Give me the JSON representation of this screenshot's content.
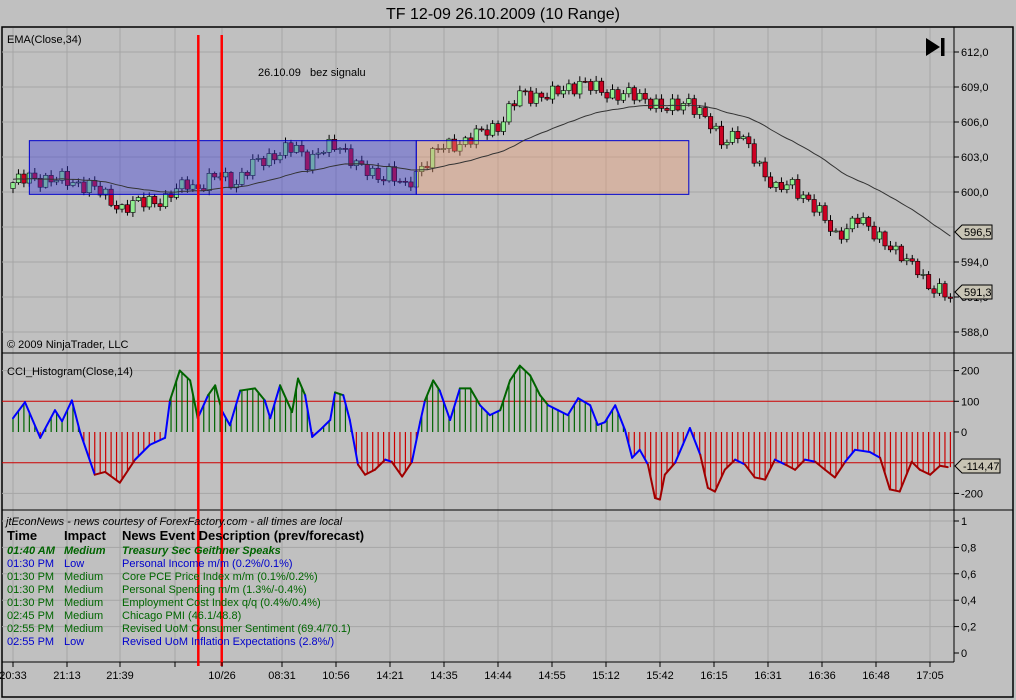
{
  "window": {
    "title": "TF 12-09  26.10.2009 (10 Range)"
  },
  "price_panel": {
    "indicator_label": "EMA(Close,34)",
    "annotation": "26.10.09   bez signalu",
    "copyright": "© 2009 NinjaTrader, LLC",
    "axis_ticks": [
      "612,0",
      "609,0",
      "606,0",
      "603,0",
      "600,0",
      "594,0",
      "591,0",
      "588,0"
    ],
    "ema_badge": "596,5",
    "last_price_badge": "591,3",
    "scroll_end_icon": "skip-to-end-icon"
  },
  "cci_panel": {
    "indicator_label": "CCI_Histogram(Close,14)",
    "axis_ticks": [
      "200",
      "100",
      "0",
      "-200"
    ],
    "value_badge": "-114,47"
  },
  "news_panel": {
    "source": "jtEconNews - news courtesy of ForexFactory.com - all times are local",
    "headers": {
      "time": "Time",
      "impact": "Impact",
      "event": "News Event Description (prev/forecast)"
    },
    "rows": [
      {
        "time": "01:40 AM",
        "impact": "Medium",
        "event": "Treasury Sec Geithner Speaks",
        "color": "#006400",
        "style": "highlight"
      },
      {
        "time": "01:30 PM",
        "impact": "Low",
        "event": "Personal Income m/m (0.2%/0.1%)",
        "color": "#0000cc"
      },
      {
        "time": "01:30 PM",
        "impact": "Medium",
        "event": "Core PCE Price Index m/m (0.1%/0.2%)",
        "color": "#006600"
      },
      {
        "time": "01:30 PM",
        "impact": "Medium",
        "event": "Personal Spending m/m (1.3%/-0.4%)",
        "color": "#006600"
      },
      {
        "time": "01:30 PM",
        "impact": "Medium",
        "event": "Employment Cost Index q/q (0.4%/0.4%)",
        "color": "#006600"
      },
      {
        "time": "02:45 PM",
        "impact": "Medium",
        "event": "Chicago PMI (46.1/48.8)",
        "color": "#006600"
      },
      {
        "time": "02:55 PM",
        "impact": "Medium",
        "event": "Revised UoM Consumer Sentiment (69.4/70.1)",
        "color": "#006600"
      },
      {
        "time": "02:55 PM",
        "impact": "Low",
        "event": "Revised UoM Inflation Expectations (2.8%/)",
        "color": "#0000cc"
      }
    ],
    "axis_ticks": [
      "1",
      "0,8",
      "0,6",
      "0,4",
      "0,2",
      "0"
    ]
  },
  "x_axis": {
    "labels": [
      "20:33",
      "21:13",
      "21:39",
      "",
      "10/26",
      "08:31",
      "10:56",
      "14:21",
      "14:35",
      "14:44",
      "14:55",
      "15:12",
      "15:42",
      "16:15",
      "16:31",
      "16:36",
      "16:48",
      "17:05"
    ]
  },
  "chart_data": {
    "type": "candlestick",
    "title": "TF 12-09  26.10.2009 (10 Range)",
    "price_range": [
      587,
      613
    ],
    "close_waypoints": [
      [
        0,
        600.8
      ],
      [
        3,
        601.2
      ],
      [
        9,
        601
      ],
      [
        14,
        600.6
      ],
      [
        20,
        598.6
      ],
      [
        25,
        599.3
      ],
      [
        28,
        599.3
      ],
      [
        32,
        600.9
      ],
      [
        34,
        600.3
      ],
      [
        38,
        601.5
      ],
      [
        41,
        600.8
      ],
      [
        45,
        602.7
      ],
      [
        52,
        603.8
      ],
      [
        54,
        602.7
      ],
      [
        57,
        603.6
      ],
      [
        60,
        604
      ],
      [
        64,
        601.9
      ],
      [
        67,
        601.3
      ],
      [
        69,
        601.8
      ],
      [
        72,
        600.2
      ],
      [
        75,
        602.3
      ],
      [
        78,
        603.6
      ],
      [
        84,
        604.6
      ],
      [
        89,
        605.7
      ],
      [
        93,
        608.3
      ],
      [
        99,
        608.3
      ],
      [
        104,
        609.4
      ],
      [
        108,
        608.6
      ],
      [
        113,
        608.3
      ],
      [
        117,
        607.9
      ],
      [
        120,
        607
      ],
      [
        124,
        607.9
      ],
      [
        127,
        606.2
      ],
      [
        130,
        604.5
      ],
      [
        133,
        605
      ],
      [
        137,
        602.3
      ],
      [
        140,
        600.2
      ],
      [
        143,
        600.6
      ],
      [
        146,
        599.3
      ],
      [
        151,
        596.3
      ],
      [
        155,
        597.6
      ],
      [
        159,
        596.3
      ],
      [
        162,
        594.6
      ],
      [
        166,
        593.7
      ],
      [
        168,
        591.6
      ],
      [
        172,
        591.2
      ]
    ],
    "ema_period": 34,
    "ema_last": 596.5,
    "last_price": 591.3,
    "zones": [
      {
        "name": "blue-zone",
        "from_bar": 3,
        "to_bar": 74,
        "low": 599.8,
        "high": 604.4,
        "color": "#3c3cdc"
      },
      {
        "name": "orange-zone",
        "from_bar": 74,
        "to_bar": 124,
        "low": 599.8,
        "high": 604.4,
        "color": "#f0a078"
      }
    ],
    "marker_bars": [
      34,
      38.3
    ],
    "cci": {
      "period": 14,
      "levels": [
        100,
        -100
      ],
      "range": [
        -260,
        250
      ],
      "waypoints": [
        [
          0,
          45
        ],
        [
          2.2,
          97
        ],
        [
          5,
          -19
        ],
        [
          7.7,
          71
        ],
        [
          9,
          35
        ],
        [
          10.8,
          103
        ],
        [
          12.3,
          0
        ],
        [
          15,
          -139
        ],
        [
          16.9,
          -130
        ],
        [
          19.6,
          -165
        ],
        [
          22.4,
          -90
        ],
        [
          25.1,
          -42
        ],
        [
          27.9,
          -19
        ],
        [
          28.8,
          103
        ],
        [
          30.6,
          200
        ],
        [
          32.5,
          168
        ],
        [
          33.9,
          45
        ],
        [
          35.8,
          120
        ],
        [
          37.1,
          152
        ],
        [
          38.3,
          70
        ],
        [
          39.8,
          22
        ],
        [
          41.7,
          135
        ],
        [
          44.4,
          142
        ],
        [
          46.2,
          103
        ],
        [
          47.2,
          45
        ],
        [
          49,
          152
        ],
        [
          51.2,
          65
        ],
        [
          52.3,
          174
        ],
        [
          53.6,
          120
        ],
        [
          54.9,
          -16
        ],
        [
          56.3,
          6
        ],
        [
          58.2,
          39
        ],
        [
          59.1,
          129
        ],
        [
          60.6,
          120
        ],
        [
          61.8,
          39
        ],
        [
          63.3,
          -106
        ],
        [
          64.6,
          -139
        ],
        [
          66.4,
          -123
        ],
        [
          68.3,
          -90
        ],
        [
          69.5,
          -97
        ],
        [
          71.4,
          -145
        ],
        [
          73.2,
          -97
        ],
        [
          74.7,
          32
        ],
        [
          75.6,
          103
        ],
        [
          77.1,
          168
        ],
        [
          78.3,
          135
        ],
        [
          80.2,
          39
        ],
        [
          82,
          142
        ],
        [
          83.9,
          142
        ],
        [
          85.7,
          87
        ],
        [
          87.5,
          55
        ],
        [
          89.4,
          71
        ],
        [
          91.2,
          168
        ],
        [
          93,
          216
        ],
        [
          94.9,
          184
        ],
        [
          96.7,
          120
        ],
        [
          98.2,
          87
        ],
        [
          100,
          71
        ],
        [
          101.8,
          55
        ],
        [
          103.7,
          110
        ],
        [
          105.9,
          87
        ],
        [
          107.3,
          23
        ],
        [
          108.6,
          32
        ],
        [
          110.5,
          87
        ],
        [
          112.3,
          6
        ],
        [
          113.6,
          -84
        ],
        [
          115,
          -58
        ],
        [
          116.5,
          -106
        ],
        [
          117.8,
          -215
        ],
        [
          118.7,
          -220
        ],
        [
          119.6,
          -139
        ],
        [
          121.5,
          -100
        ],
        [
          122.9,
          -42
        ],
        [
          124.2,
          13
        ],
        [
          126.1,
          -74
        ],
        [
          127.5,
          -182
        ],
        [
          128.8,
          -194
        ],
        [
          130.6,
          -123
        ],
        [
          132.5,
          -90
        ],
        [
          134.3,
          -106
        ],
        [
          136.1,
          -148
        ],
        [
          138,
          -155
        ],
        [
          139.8,
          -90
        ],
        [
          141.7,
          -106
        ],
        [
          143.5,
          -123
        ],
        [
          145.3,
          -90
        ],
        [
          147.2,
          -97
        ],
        [
          149,
          -123
        ],
        [
          150.8,
          -148
        ],
        [
          152.7,
          -97
        ],
        [
          154.5,
          -58
        ],
        [
          157.2,
          -65
        ],
        [
          159.1,
          -84
        ],
        [
          160.9,
          -187
        ],
        [
          162.7,
          -194
        ],
        [
          164.9,
          -97
        ],
        [
          166.4,
          -123
        ],
        [
          168.3,
          -139
        ],
        [
          170.1,
          -110
        ],
        [
          171.5,
          -114.47
        ]
      ]
    },
    "colors": {
      "up": "#90ee90",
      "down": "#cc0022",
      "ema": "#333333",
      "cci_up": "#006400",
      "cci_down": "#cc0000",
      "cci_line_mid": "#0000ff"
    }
  }
}
